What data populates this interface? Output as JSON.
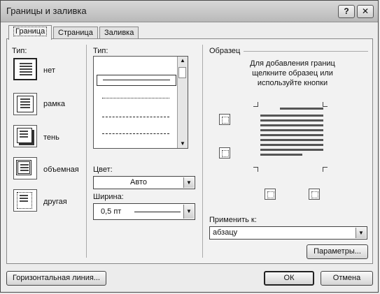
{
  "window": {
    "title": "Границы и заливка",
    "help_label": "?",
    "close_label": "✕"
  },
  "tabs": [
    {
      "label": "Граница",
      "active": true
    },
    {
      "label": "Страница",
      "active": false
    },
    {
      "label": "Заливка",
      "active": false
    }
  ],
  "type_section": {
    "label": "Тип:",
    "options": [
      {
        "label": "нет",
        "selected": true
      },
      {
        "label": "рамка",
        "selected": false
      },
      {
        "label": "тень",
        "selected": false
      },
      {
        "label": "объемная",
        "selected": false
      },
      {
        "label": "другая",
        "selected": false
      }
    ]
  },
  "style_section": {
    "label": "Тип:",
    "styles": [
      "solid",
      "dotted",
      "dashed",
      "dashed-long",
      "dash-dot"
    ],
    "selected_index": 0
  },
  "color": {
    "label": "Цвет:",
    "value": "Авто"
  },
  "width": {
    "label": "Ширина:",
    "value": "0,5 пт"
  },
  "preview": {
    "label": "Образец",
    "hint_line1": "Для добавления границ",
    "hint_line2": "щелкните образец или",
    "hint_line3": "используйте кнопки"
  },
  "apply_to": {
    "label": "Применить к:",
    "value": "абзацу"
  },
  "buttons": {
    "options": "Параметры...",
    "horizontal_line": "Горизонтальная линия...",
    "ok": "ОК",
    "cancel": "Отмена"
  }
}
